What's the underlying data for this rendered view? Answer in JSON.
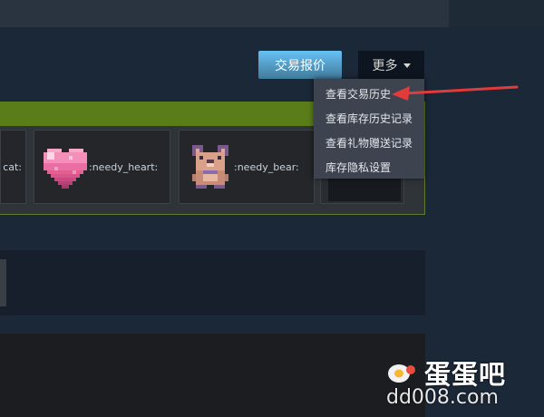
{
  "header": {
    "trade_offers_button": "交易报价",
    "more_button": "更多"
  },
  "more_menu": {
    "items": [
      "查看交易历史",
      "查看库存历史记录",
      "查看礼物赠送记录",
      "库存隐私设置"
    ]
  },
  "inventory": {
    "items": [
      {
        "label": ":cat:",
        "visible_text": "cat:"
      },
      {
        "label": ":needy_heart:",
        "icon": "pixel-heart-icon"
      },
      {
        "label": ":needy_bear:",
        "icon": "pixel-bear-icon"
      },
      {
        "label": "",
        "icon": "dark-thumbnail"
      }
    ]
  },
  "annotation": {
    "color": "#e23b3b",
    "target": "查看交易历史"
  },
  "watermark": {
    "name": "蛋蛋吧",
    "domain": "dd008.com"
  },
  "colors": {
    "background": "#1b2838",
    "button_blue": "#67c1f5",
    "menu_bg": "#3d4450",
    "header_green": "#5a7d1a"
  }
}
